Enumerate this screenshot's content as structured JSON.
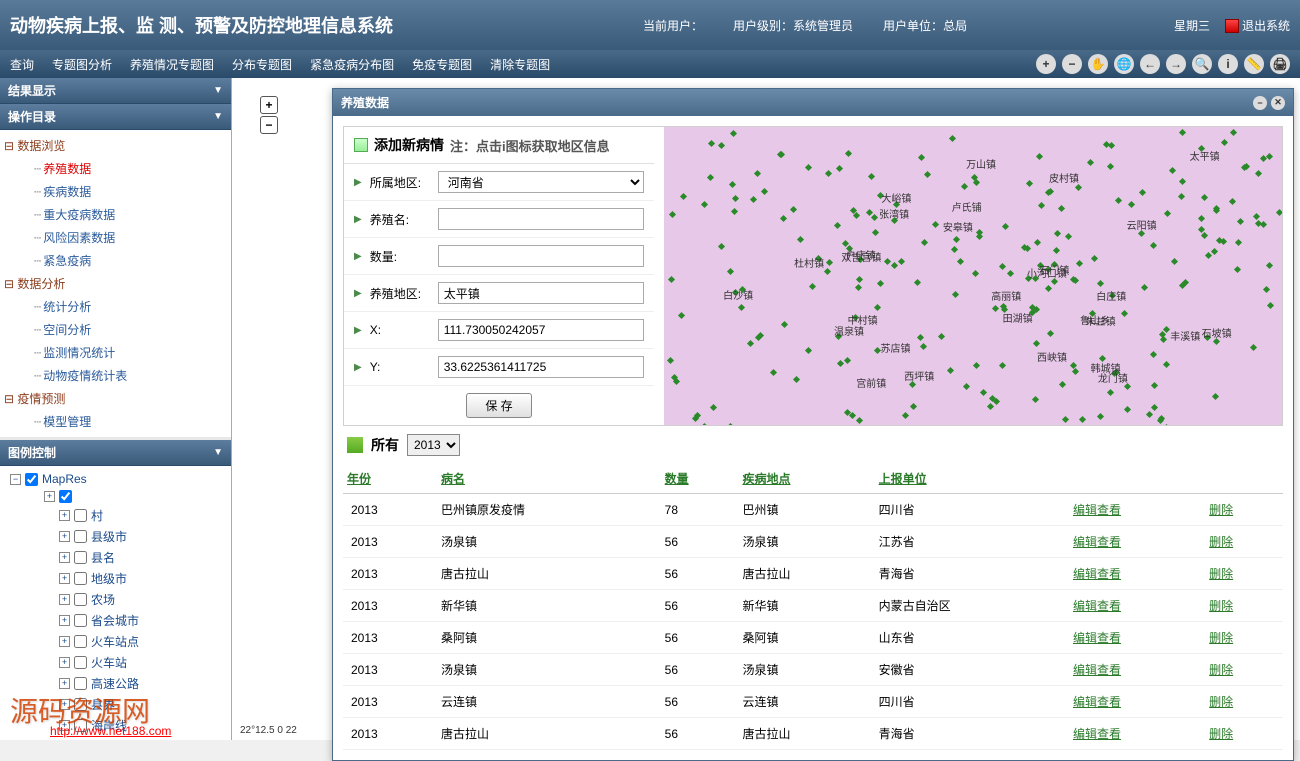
{
  "header": {
    "title": "动物疾病上报、监 测、预警及防控地理信息系统",
    "current_user_label": "当前用户：",
    "user_level_label": "用户级别：",
    "user_level": "系统管理员",
    "user_unit_label": "用户单位：",
    "user_unit": "总局",
    "weekday": "星期三",
    "logout": "退出系统"
  },
  "menu": {
    "items": [
      "查询",
      "专题图分析",
      "养殖情况专题图",
      "分布专题图",
      "紧急疫病分布图",
      "免疫专题图",
      "清除专题图"
    ]
  },
  "panels": {
    "result": "结果显示",
    "catalog": "操作目录",
    "legend": "图例控制"
  },
  "tree": {
    "g0": "数据浏览",
    "g0_items": [
      "养殖数据",
      "疾病数据",
      "重大疫病数据",
      "风险因素数据",
      "紧急疫病"
    ],
    "g1": "数据分析",
    "g1_items": [
      "统计分析",
      "空间分析",
      "监测情况统计",
      "动物疫情统计表"
    ],
    "g2": "疫情预测",
    "g2_items": [
      "模型管理"
    ]
  },
  "legend": {
    "root": "MapRes",
    "items": [
      "村",
      "县级市",
      "县名",
      "地级市",
      "农场",
      "省会城市",
      "火车站点",
      "火车站",
      "高速公路",
      "县界",
      "海岸线"
    ]
  },
  "dialog": {
    "title": "养殖数据",
    "formTitle": "添加新病情",
    "notice": "注：点击i图标获取地区信息",
    "fields": {
      "region_label": "所属地区:",
      "region_value": "河南省",
      "name_label": "养殖名:",
      "name_value": "",
      "qty_label": "数量:",
      "qty_value": "",
      "area_label": "养殖地区:",
      "area_value": "太平镇",
      "x_label": "X:",
      "x_value": "111.730050242057",
      "y_label": "Y:",
      "y_value": "33.6225361411725"
    },
    "save": "保 存"
  },
  "map_labels": [
    "太平镇",
    "龙门镇",
    "西坪镇",
    "云阳镇",
    "石坡镇",
    "户庄镇",
    "田湖镇",
    "温泉镇",
    "万山镇",
    "大峪镇",
    "西峡镇",
    "安皋镇",
    "朱兰镇",
    "宫前镇",
    "小河口镇",
    "中村镇",
    "皮村镇",
    "白沙镇",
    "石门镇",
    "双吉宫镇",
    "丰溪镇",
    "白庄镇",
    "张湾镇",
    "卢氏铺",
    "杜村镇",
    "鲁山乡",
    "高丽镇",
    "韩城镇",
    "苏店镇"
  ],
  "year_bar": {
    "all": "所有",
    "year": "2013"
  },
  "table": {
    "headers": [
      "年份",
      "病名",
      "数量",
      "疾病地点",
      "上报单位"
    ],
    "edit": "编辑查看",
    "del": "删除",
    "rows": [
      {
        "y": "2013",
        "n": "巴州镇原发疫情",
        "q": "78",
        "p": "巴州镇",
        "u": "四川省"
      },
      {
        "y": "2013",
        "n": "汤泉镇",
        "q": "56",
        "p": "汤泉镇",
        "u": "江苏省"
      },
      {
        "y": "2013",
        "n": "唐古拉山",
        "q": "56",
        "p": "唐古拉山",
        "u": "青海省"
      },
      {
        "y": "2013",
        "n": "新华镇",
        "q": "56",
        "p": "新华镇",
        "u": "内蒙古自治区"
      },
      {
        "y": "2013",
        "n": "桑阿镇",
        "q": "56",
        "p": "桑阿镇",
        "u": "山东省"
      },
      {
        "y": "2013",
        "n": "汤泉镇",
        "q": "56",
        "p": "汤泉镇",
        "u": "安徽省"
      },
      {
        "y": "2013",
        "n": "云连镇",
        "q": "56",
        "p": "云连镇",
        "u": "四川省"
      },
      {
        "y": "2013",
        "n": "唐古拉山",
        "q": "56",
        "p": "唐古拉山",
        "u": "青海省"
      }
    ]
  },
  "watermark": "源码资源网",
  "watermark_url": "http://www.net188.com",
  "scale": "22°12.5 0       22"
}
